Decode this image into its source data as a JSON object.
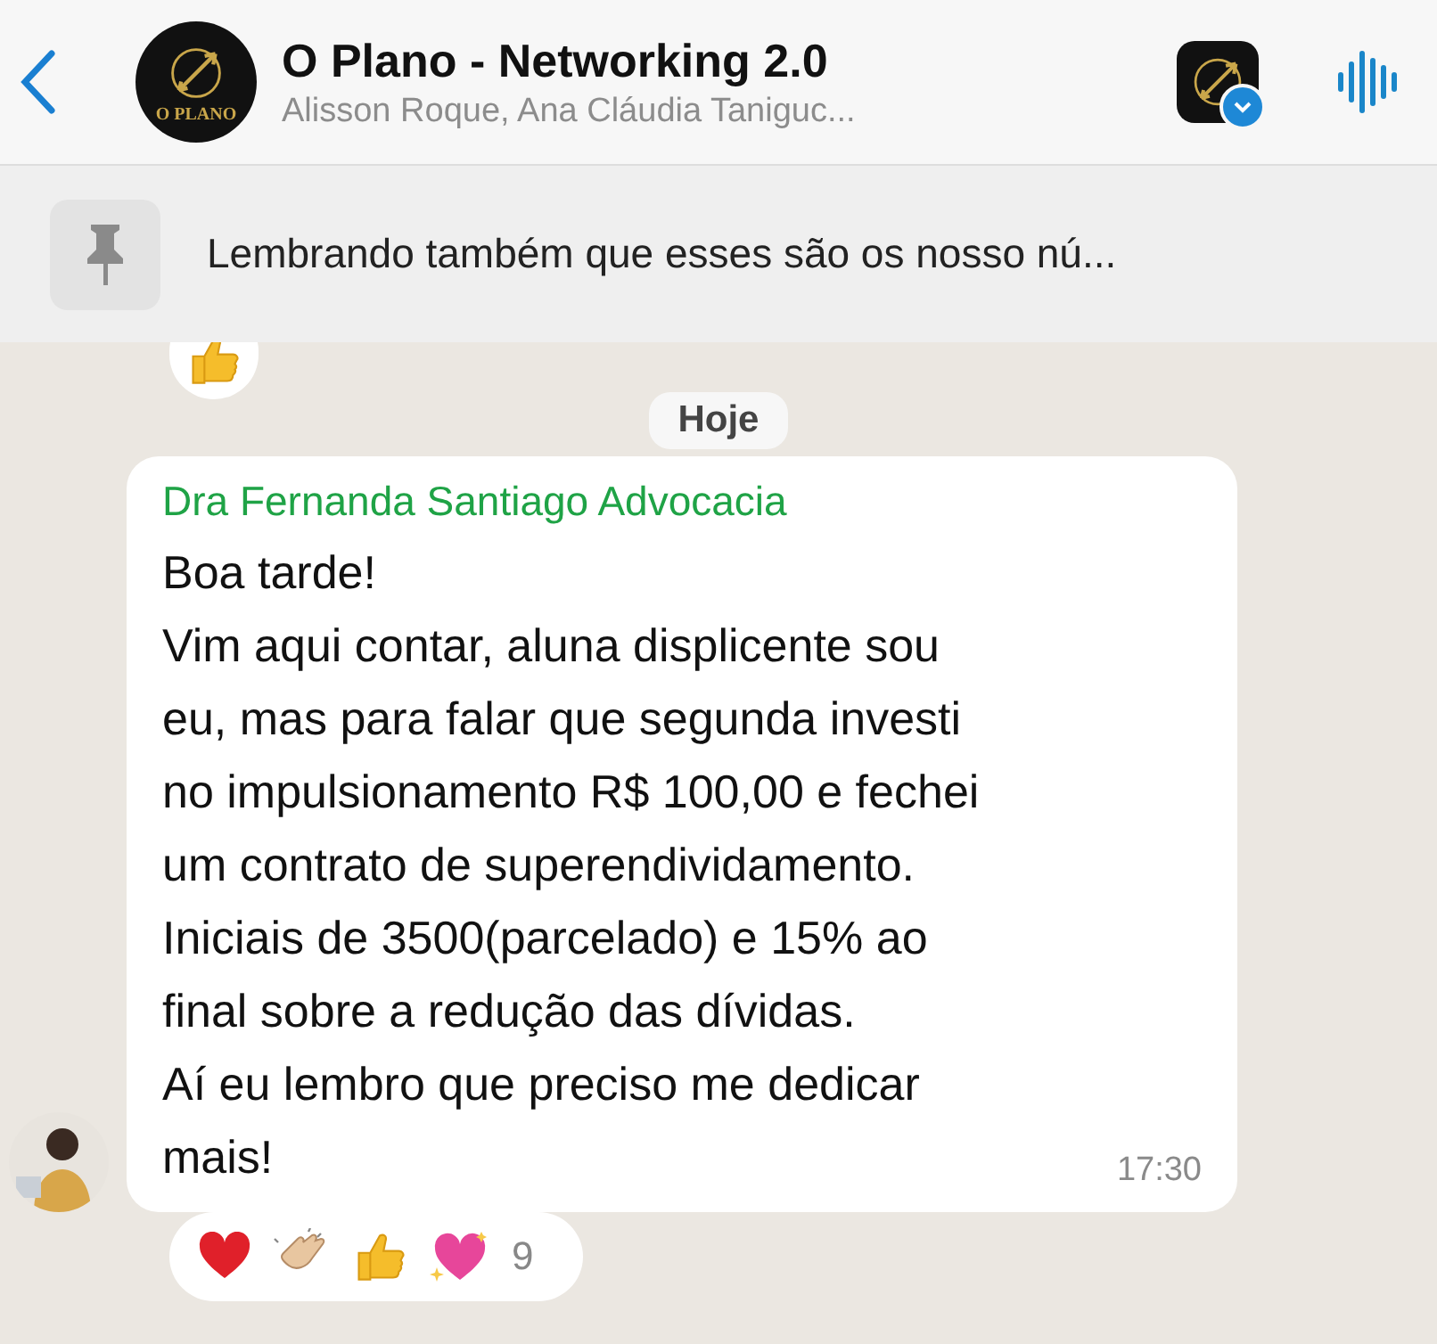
{
  "header": {
    "title": "O Plano - Networking 2.0",
    "subtitle": "Alisson Roque, Ana Cláudia Taniguc...",
    "avatar_label": "O PLANO"
  },
  "pinned": {
    "text": "Lembrando também que esses são os nosso nú..."
  },
  "date_chip": "Hoje",
  "message": {
    "sender": "Dra Fernanda Santiago Advocacia",
    "text": "Boa tarde!\nVim aqui contar, aluna displicente sou\neu, mas para falar que segunda investi\nno impulsionamento R$ 100,00 e fechei\num contrato de superendividamento.\nIniciais de 3500(parcelado) e 15% ao\nfinal sobre a redução das dívidas.\nAí eu lembro que preciso me dedicar\nmais!",
    "time": "17:30",
    "reaction_count": "9"
  }
}
